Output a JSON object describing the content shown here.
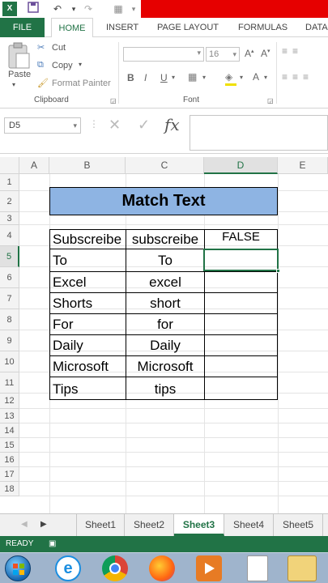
{
  "ribbon": {
    "tabs": [
      "FILE",
      "HOME",
      "INSERT",
      "PAGE LAYOUT",
      "FORMULAS",
      "DATA"
    ],
    "clipboard": {
      "paste_label": "Paste",
      "cut_label": "Cut",
      "copy_label": "Copy",
      "format_painter_label": "Format Painter",
      "group_label": "Clipboard"
    },
    "font": {
      "size": "16",
      "group_label": "Font",
      "bold": "B",
      "italic": "I",
      "underline": "U"
    }
  },
  "formula_bar": {
    "name_box": "D5",
    "fx": "fx"
  },
  "columns": [
    "A",
    "B",
    "C",
    "D",
    "E"
  ],
  "selected_column": "D",
  "rows": [
    "1",
    "2",
    "3",
    "4",
    "5",
    "6",
    "7",
    "8",
    "9",
    "10",
    "11",
    "12",
    "13",
    "14",
    "15",
    "16",
    "17",
    "18"
  ],
  "selected_row": "5",
  "sheet": {
    "title": "Match Text",
    "result": "FALSE",
    "pairs": [
      {
        "b": "Subscreibe",
        "c": "subscreibe"
      },
      {
        "b": "To",
        "c": "To"
      },
      {
        "b": "Excel",
        "c": "excel"
      },
      {
        "b": "Shorts",
        "c": "short"
      },
      {
        "b": "For",
        "c": "for"
      },
      {
        "b": "Daily",
        "c": "Daily"
      },
      {
        "b": "Microsoft",
        "c": "Microsoft"
      },
      {
        "b": "Tips",
        "c": "tips"
      }
    ]
  },
  "sheet_tabs": [
    "Sheet1",
    "Sheet2",
    "Sheet3",
    "Sheet4",
    "Sheet5"
  ],
  "active_sheet": "Sheet3",
  "status": "READY",
  "colors": {
    "excel_green": "#217346",
    "title_fill": "#8eb4e3",
    "red_bar": "#e60000"
  }
}
